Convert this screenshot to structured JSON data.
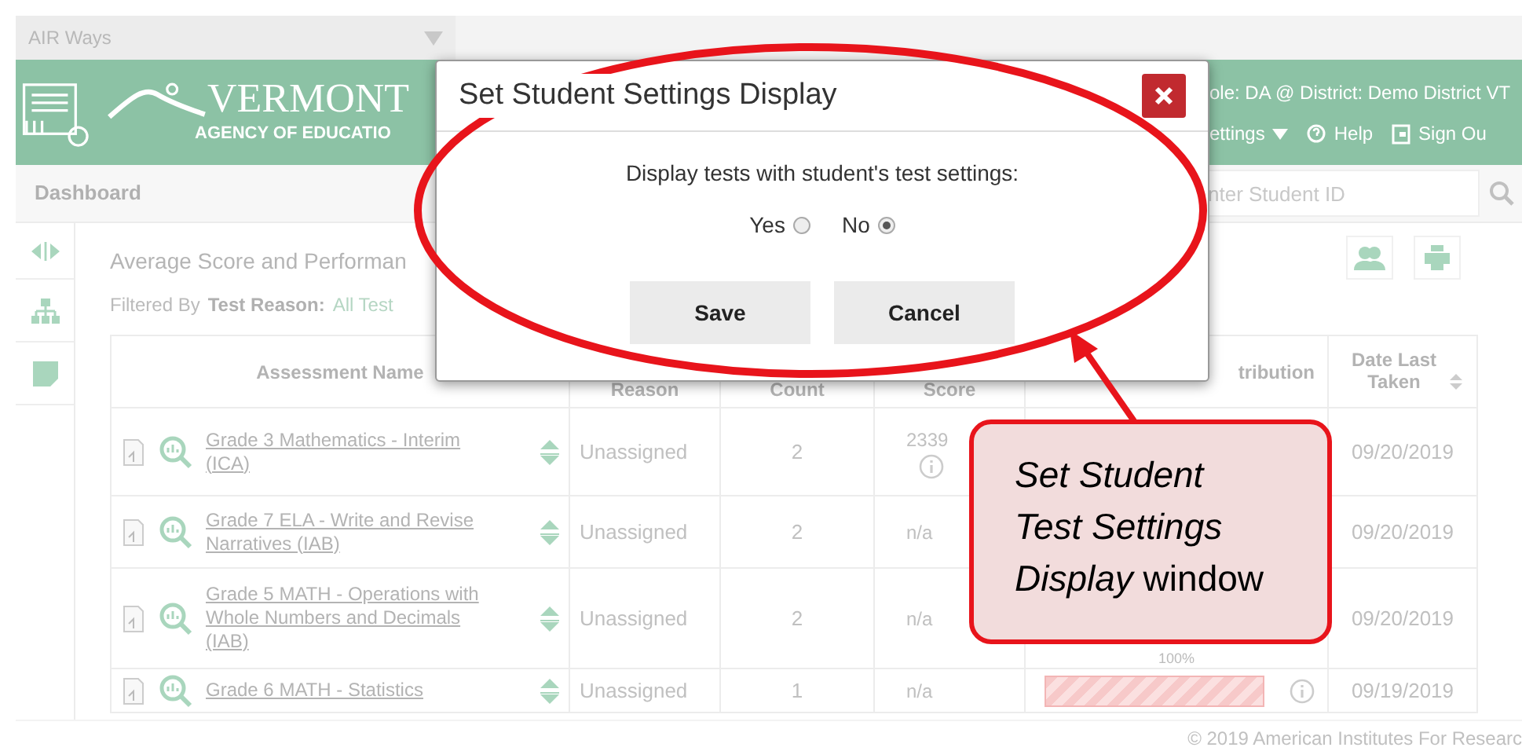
{
  "app_bar": {
    "title": "AIR Ways"
  },
  "header": {
    "logo_title": "VERMONT",
    "logo_subtitle": "AGENCY OF EDUCATIO",
    "user_role": "ole: DA @ District: Demo District VT",
    "menu": [
      {
        "kind": "dropdown",
        "label": "ettings"
      },
      {
        "kind": "help",
        "label": "Help"
      },
      {
        "kind": "signout",
        "label": "Sign Ou"
      }
    ]
  },
  "nav": {
    "title": "Dashboard",
    "search": {
      "placeholder": "nter Student ID"
    }
  },
  "report": {
    "title": "Average Score and Performan",
    "filter_label": "Filtered By",
    "filter_name": "Test Reason:",
    "filter_value": "All Test"
  },
  "table": {
    "columns": [
      "Assessment Name",
      "Reason",
      "Count",
      "Score",
      "tribution",
      "Date Last Taken"
    ],
    "rows": [
      {
        "assessment": "Grade 3 Mathematics - Interim (ICA)",
        "reason": "Unassigned",
        "count": "2",
        "score": "2339",
        "score_info": true,
        "date": "09/20/2019"
      },
      {
        "assessment": "Grade 7 ELA - Write and Revise Narratives (IAB)",
        "reason": "Unassigned",
        "count": "2",
        "score": "n/a",
        "score_info": false,
        "date": "09/20/2019"
      },
      {
        "assessment": "Grade 5 MATH - Operations with Whole Numbers and Decimals (IAB)",
        "reason": "Unassigned",
        "count": "2",
        "score": "n/a",
        "score_info": false,
        "distribution_text": "100%",
        "date": "09/20/2019"
      },
      {
        "assessment": "Grade 6 MATH - Statistics",
        "reason": "Unassigned",
        "count": "1",
        "score": "n/a",
        "score_info": false,
        "distribution_bar": true,
        "date": "09/19/2019"
      }
    ]
  },
  "modal": {
    "title": "Set Student Settings Display",
    "prompt": "Display tests with student's test settings:",
    "options": [
      {
        "label": "Yes",
        "selected": false
      },
      {
        "label": "No",
        "selected": true
      }
    ],
    "buttons": [
      "Save",
      "Cancel"
    ]
  },
  "callout": {
    "text": "*Set Student Test Settings Display* window"
  },
  "footer": {
    "copyright": "© 2019 American Institutes For Researc"
  }
}
